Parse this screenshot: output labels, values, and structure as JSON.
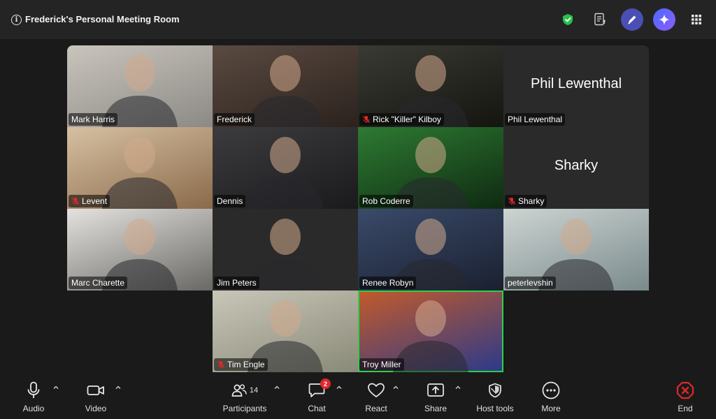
{
  "meeting": {
    "title": "Frederick's Personal Meeting Room",
    "info_glyph": "i"
  },
  "colors": {
    "active_speaker": "#2bd14a",
    "shield": "#27c24c",
    "mute": "#e02828",
    "end": "#e02828"
  },
  "participants": [
    {
      "name": "Mark Harris",
      "muted": false,
      "video": true,
      "bg": [
        "#c9c4bc",
        "#8c8a86"
      ]
    },
    {
      "name": "Frederick",
      "muted": false,
      "video": true,
      "bg": [
        "#5a4a40",
        "#2b221e"
      ]
    },
    {
      "name": "Rick \"Killer\" Kilboy",
      "muted": true,
      "video": true,
      "bg": [
        "#3a3a34",
        "#15150f"
      ]
    },
    {
      "name": "Phil Lewenthal",
      "muted": false,
      "video": false,
      "big_label": "Phil Lewenthal"
    },
    {
      "name": "Levent",
      "muted": true,
      "video": true,
      "bg": [
        "#d6c0a2",
        "#8a6a4a"
      ]
    },
    {
      "name": "Dennis",
      "muted": false,
      "video": true,
      "bg": [
        "#3c3c3e",
        "#1a1a1c"
      ]
    },
    {
      "name": "Rob Coderre",
      "muted": false,
      "video": true,
      "bg": [
        "#2d7a32",
        "#0f2a12"
      ]
    },
    {
      "name": "Sharky",
      "muted": true,
      "video": false,
      "big_label": "Sharky"
    },
    {
      "name": "Marc Charette",
      "muted": false,
      "video": true,
      "bg": [
        "#e4e2de",
        "#6a6864"
      ]
    },
    {
      "name": "Jim Peters",
      "muted": false,
      "video": true,
      "bg": [
        "#2a2a2a",
        "#2a2a2a"
      ]
    },
    {
      "name": "Renee Robyn",
      "muted": false,
      "video": true,
      "bg": [
        "#3a4a6a",
        "#1a2030"
      ]
    },
    {
      "name": "peterlevshin",
      "muted": false,
      "video": true,
      "bg": [
        "#cdd4d2",
        "#7a8a8c"
      ]
    },
    {
      "name": "Tim Engle",
      "muted": true,
      "video": true,
      "bg": [
        "#c8c6b8",
        "#8a8a78"
      ]
    },
    {
      "name": "Troy Miller",
      "muted": false,
      "video": true,
      "active": true,
      "bg": [
        "#c45a2a",
        "#2a3a8a"
      ]
    }
  ],
  "toolbar": {
    "audio": "Audio",
    "video": "Video",
    "participants": "Participants",
    "participants_count": "14",
    "chat": "Chat",
    "chat_badge": "2",
    "react": "React",
    "share": "Share",
    "host_tools": "Host tools",
    "more": "More",
    "end": "End"
  }
}
